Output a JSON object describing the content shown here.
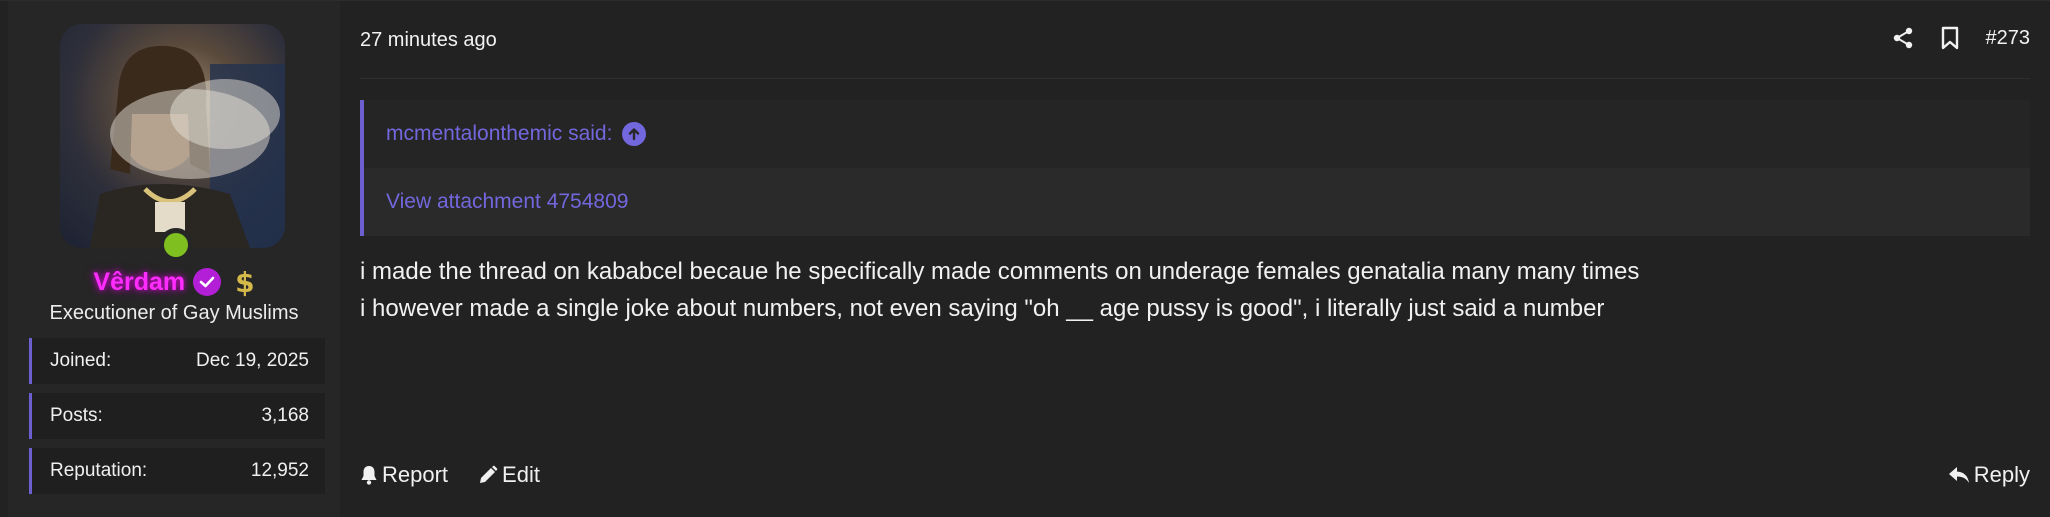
{
  "user": {
    "username": "Vêrdam",
    "title": "Executioner of Gay Muslims",
    "stats": [
      {
        "label": "Joined:",
        "value": "Dec 19, 2025"
      },
      {
        "label": "Posts:",
        "value": "3,168"
      },
      {
        "label": "Reputation:",
        "value": "12,952"
      }
    ]
  },
  "post": {
    "timestamp": "27 minutes ago",
    "number": "#273",
    "quote": {
      "author_line": "mcmentalonthemic said:",
      "attachment_link": "View attachment 4754809"
    },
    "message_lines": [
      "i made the thread on kababcel becaue he specifically made comments on underage females genatalia many many times",
      "i however made a single joke about numbers, not even saying \"oh __ age pussy is good\", i literally just said a number"
    ]
  },
  "actions": {
    "report": "Report",
    "edit": "Edit",
    "reply": "Reply"
  },
  "icons": [
    "share-icon",
    "bookmark-icon",
    "quote-arrow-icon",
    "bell-icon",
    "pencil-icon",
    "reply-icon",
    "verified-icon",
    "dollar-icon"
  ],
  "colors": {
    "accent": "#6d5fd0",
    "username": "#ff2cff",
    "online": "#7fbf1f"
  }
}
